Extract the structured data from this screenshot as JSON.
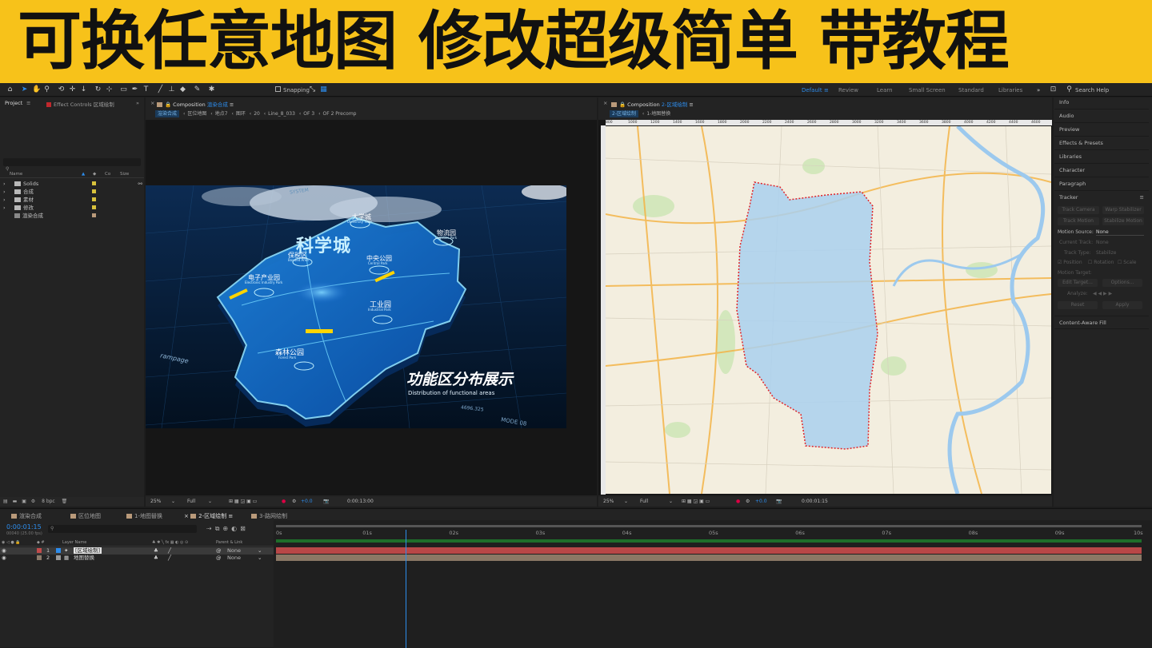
{
  "banner": {
    "title": "可换任意地图 修改超级简单 带教程"
  },
  "toolbar": {
    "snapping_label": "Snapping",
    "workspaces": [
      "Default",
      "Review",
      "Learn",
      "Small Screen",
      "Standard",
      "Libraries"
    ],
    "active_workspace": "Default",
    "search_placeholder": "Search Help"
  },
  "project_panel": {
    "tab_project": "Project",
    "tab_effect_controls": "Effect Controls 区域绘制",
    "col_name": "Name",
    "col_comment": "Co",
    "col_size": "Size",
    "items": [
      {
        "name": "Solids",
        "type": "folder"
      },
      {
        "name": "合成",
        "type": "folder"
      },
      {
        "name": "素材",
        "type": "folder"
      },
      {
        "name": "修改",
        "type": "folder"
      },
      {
        "name": "渲染合成",
        "type": "comp"
      }
    ],
    "bpc": "8 bpc"
  },
  "comp_left": {
    "tab_label": "Composition",
    "comp_name": "渲染合成",
    "breadcrumbs": [
      "渲染合成",
      "区位地图",
      "地点7",
      "图环",
      "20",
      "Line_8_033",
      "OF 3",
      "OF 2 Precomp"
    ],
    "zoom": "25%",
    "resolution": "Full",
    "exposure": "+0.0",
    "timecode": "0:00:13:00",
    "scene": {
      "title": "科学城",
      "labels": [
        {
          "zh": "大学城",
          "en": "University Town"
        },
        {
          "zh": "物流园",
          "en": "Logistics Park"
        },
        {
          "zh": "保税区",
          "en": "Bonded Area"
        },
        {
          "zh": "中央公园",
          "en": "Central Park"
        },
        {
          "zh": "电子产业园",
          "en": "Electronic Industry Park"
        },
        {
          "zh": "工业园",
          "en": "Industrial Park"
        },
        {
          "zh": "森林公园",
          "en": "Forest Park"
        }
      ],
      "heading": "功能区分布展示",
      "subheading": "Distribution of functional areas",
      "hud_text": [
        "SYSTEM",
        "MODE 08",
        "4696.325",
        "rampage"
      ]
    }
  },
  "comp_right": {
    "tab_label": "Composition",
    "comp_name": "2-区域绘制",
    "breadcrumbs": [
      "2-区域绘制",
      "1-地图替换"
    ],
    "ruler": [
      "800",
      "1000",
      "1200",
      "1400",
      "1600",
      "1800",
      "2000",
      "2200",
      "2400",
      "2600",
      "2800",
      "3000",
      "3200",
      "3400",
      "3600",
      "3800",
      "4000",
      "4200",
      "4400",
      "4600"
    ],
    "zoom": "25%",
    "resolution": "Full",
    "exposure": "+0.0",
    "timecode": "0:00:01:15"
  },
  "right_panel": {
    "sections": [
      "Info",
      "Audio",
      "Preview",
      "Effects & Presets",
      "Libraries",
      "Character",
      "Paragraph"
    ],
    "tracker": {
      "title": "Tracker",
      "buttons_row1": [
        "Track Camera",
        "Warp Stabilizer"
      ],
      "buttons_row2": [
        "Track Motion",
        "Stabilize Motion"
      ],
      "motion_source_label": "Motion Source:",
      "motion_source_value": "None",
      "current_track_label": "Current Track:",
      "current_track_value": "None",
      "track_type_label": "Track Type:",
      "track_type_value": "Stabilize",
      "checks": [
        "Position",
        "Rotation",
        "Scale"
      ],
      "motion_target": "Motion Target:",
      "edit_target": "Edit Target...",
      "options": "Options...",
      "analyze": "Analyze:",
      "reset": "Reset",
      "apply": "Apply"
    },
    "content_aware": "Content-Aware Fill"
  },
  "timeline": {
    "tabs": [
      "渲染合成",
      "区位地图",
      "1-地图替换",
      "2-区域绘制",
      "3-路网绘制"
    ],
    "active_tab": "2-区域绘制",
    "timecode": "0:00:01:15",
    "frames": "00040 (25.00 fps)",
    "col_layer": "Layer Name",
    "col_parent": "Parent & Link",
    "ticks": [
      "0s",
      "01s",
      "02s",
      "03s",
      "04s",
      "05s",
      "06s",
      "07s",
      "08s",
      "09s",
      "10s"
    ],
    "playhead_fraction": 0.15,
    "layers": [
      {
        "num": "1",
        "name": "[区域绘制]",
        "parent": "None",
        "color": "#c24b4b"
      },
      {
        "num": "2",
        "name": "地图替换",
        "parent": "None",
        "color": "#8a7a6a"
      }
    ]
  },
  "colors": {
    "accent": "#2d8ceb",
    "banner": "#f7c21a",
    "area_outline": "#e0242a",
    "area_fill": "#a9d0ee"
  }
}
